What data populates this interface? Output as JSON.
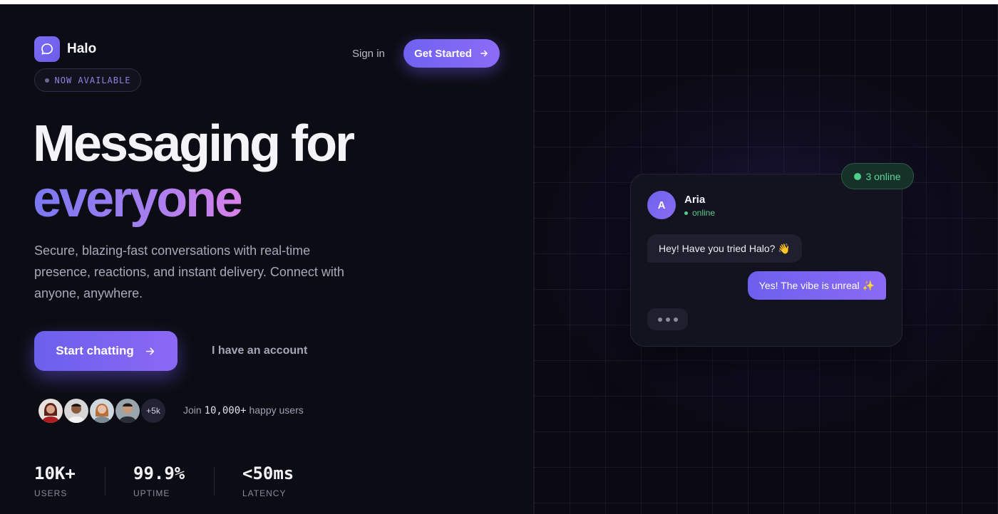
{
  "brand": {
    "name": "Halo",
    "logo_icon": "chat-bubble-icon",
    "accent": "#6c5ce7"
  },
  "nav": {
    "signin_label": "Sign in",
    "get_started_label": "Get Started",
    "get_started_icon": "arrow-right-icon"
  },
  "badge": {
    "label": "NOW AVAILABLE"
  },
  "hero": {
    "line1": "Messaging for",
    "line2": "everyone",
    "subtext": "Secure, blazing-fast conversations with real-time presence, reactions, and instant delivery. Connect with anyone, anywhere."
  },
  "cta": {
    "primary_label": "Start chatting",
    "primary_icon": "arrow-right-icon",
    "secondary_label": "I have an account"
  },
  "social_proof": {
    "avatars": [
      "user-avatar-1",
      "user-avatar-2",
      "user-avatar-3",
      "user-avatar-4"
    ],
    "more_label": "+5k",
    "join_prefix": "Join",
    "join_count": "10,000+",
    "join_suffix": "happy users"
  },
  "stats": [
    {
      "value": "10K+",
      "label": "USERS"
    },
    {
      "value": "99.9%",
      "label": "UPTIME"
    },
    {
      "value": "<50ms",
      "label": "LATENCY"
    }
  ],
  "chat_preview": {
    "online_label": "3 online",
    "contact": {
      "initial": "A",
      "name": "Aria",
      "status": "online"
    },
    "messages": [
      {
        "direction": "in",
        "text": "Hey! Have you tried Halo? 👋"
      },
      {
        "direction": "out",
        "text": "Yes! The vibe is unreal ✨"
      }
    ],
    "typing_indicator": true
  }
}
